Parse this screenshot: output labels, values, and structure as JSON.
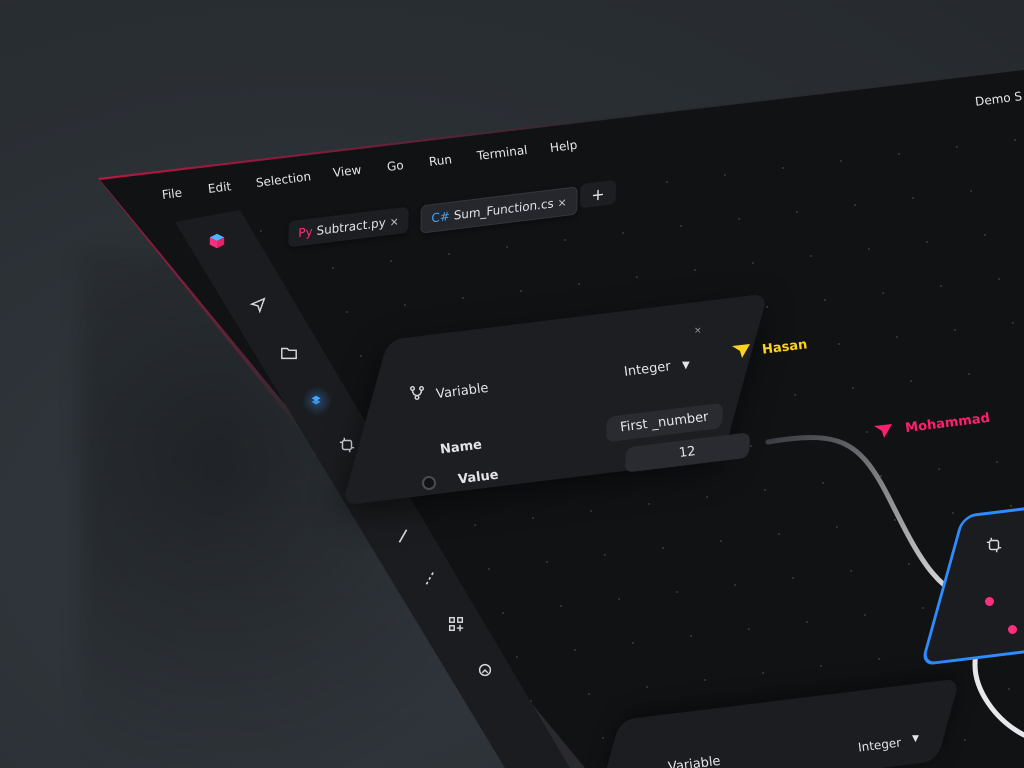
{
  "menu": {
    "items": [
      "File",
      "Edit",
      "Selection",
      "View",
      "Go",
      "Run",
      "Terminal",
      "Help"
    ]
  },
  "demo_label": "Demo S",
  "tabs": [
    {
      "lang": "Py",
      "name": "Subtract.py",
      "close": "×"
    },
    {
      "lang": "C#",
      "name": "Sum_Function.cs",
      "close": "×"
    }
  ],
  "add_tab_label": "+",
  "sidebar": {
    "icons": [
      "cube-logo-icon",
      "send-icon",
      "folder-icon",
      "blocks-icon",
      "function-node-icon",
      "branch-icon",
      "line-icon",
      "dashed-line-icon",
      "add-widget-icon",
      "debug-icon"
    ]
  },
  "node": {
    "title": "Variable",
    "type": "Integer",
    "name_label": "Name",
    "value_label": "Value",
    "name_value": "First _number",
    "value_value": "12"
  },
  "node2": {
    "title": "Variable",
    "type": "Integer"
  },
  "cursors": [
    {
      "name": "Hasan",
      "color": "#ffd21f"
    },
    {
      "name": "Mohammad",
      "color": "#ff1f6e"
    }
  ],
  "colors": {
    "accent_pink": "#ff1f6e",
    "accent_blue": "#2f8cff",
    "cursor_yellow": "#ffd21f"
  }
}
